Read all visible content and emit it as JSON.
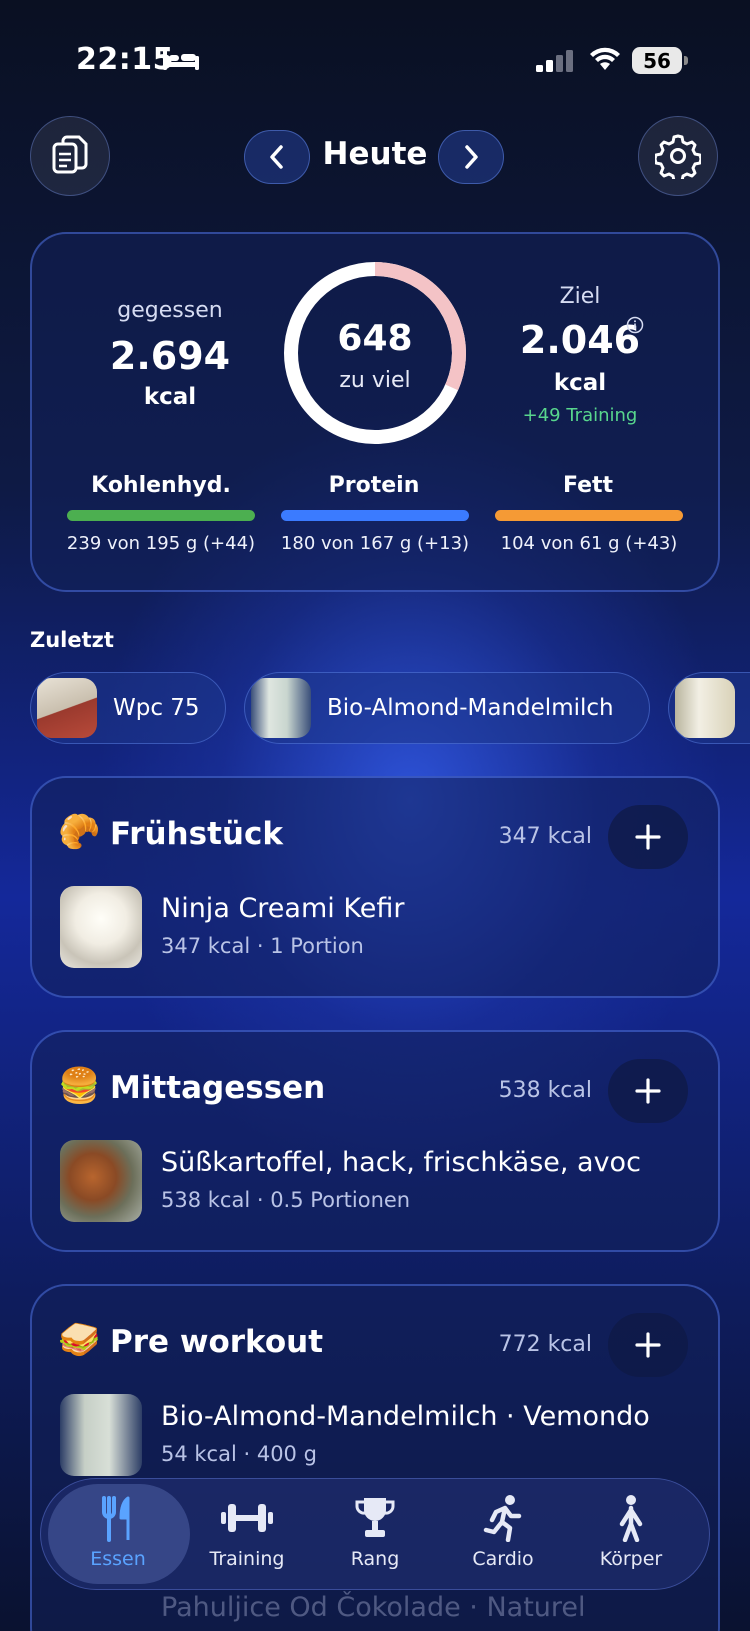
{
  "status": {
    "time": "22:15",
    "battery": "56"
  },
  "nav": {
    "day": "Heute"
  },
  "summary": {
    "eaten_label": "gegessen",
    "eaten_value": "2.694",
    "eaten_unit": "kcal",
    "ring_value": "648",
    "ring_label": "zu viel",
    "ring_over_fraction": 0.317,
    "goal_label": "Ziel",
    "goal_value": "2.046",
    "goal_unit": "kcal",
    "goal_training": "+49 Training",
    "macros": [
      {
        "label": "Kohlenhyd.",
        "detail": "239 von 195 g (+44)",
        "color": "#4caf50"
      },
      {
        "label": "Protein",
        "detail": "180 von 167 g (+13)",
        "color": "#3b7bff"
      },
      {
        "label": "Fett",
        "detail": "104 von 61 g (+43)",
        "color": "#f59a35"
      }
    ]
  },
  "recent": {
    "title": "Zuletzt",
    "items": [
      {
        "label": "Wpc 75"
      },
      {
        "label": "Bio-Almond-Mandelmilch"
      },
      {
        "label": ""
      }
    ]
  },
  "meals": [
    {
      "emoji": "🥐",
      "title": "Frühstück",
      "kcal": "347 kcal",
      "items": [
        {
          "name": "Ninja Creami Kefir",
          "detail": "347 kcal · 1 Portion"
        }
      ]
    },
    {
      "emoji": "🍔",
      "title": "Mittagessen",
      "kcal": "538 kcal",
      "items": [
        {
          "name": "Süßkartoffel, hack, frischkäse, avoc",
          "detail": "538 kcal · 0.5 Portionen"
        }
      ]
    },
    {
      "emoji": "🥪",
      "title": "Pre workout",
      "kcal": "772 kcal",
      "items": [
        {
          "name": "Bio-Almond-Mandelmilch · Vemondo",
          "detail": "54 kcal · 400 g"
        },
        {
          "name": "Pahuljice Od Čokolade · Naturel",
          "detail": ""
        }
      ]
    }
  ],
  "tabs": [
    {
      "label": "Essen",
      "active": true
    },
    {
      "label": "Training",
      "active": false
    },
    {
      "label": "Rang",
      "active": false
    },
    {
      "label": "Cardio",
      "active": false
    },
    {
      "label": "Körper",
      "active": false
    }
  ],
  "colors": {
    "accent": "#5aa3ff",
    "over": "#f4c3c6",
    "training_green": "#58d68d"
  }
}
